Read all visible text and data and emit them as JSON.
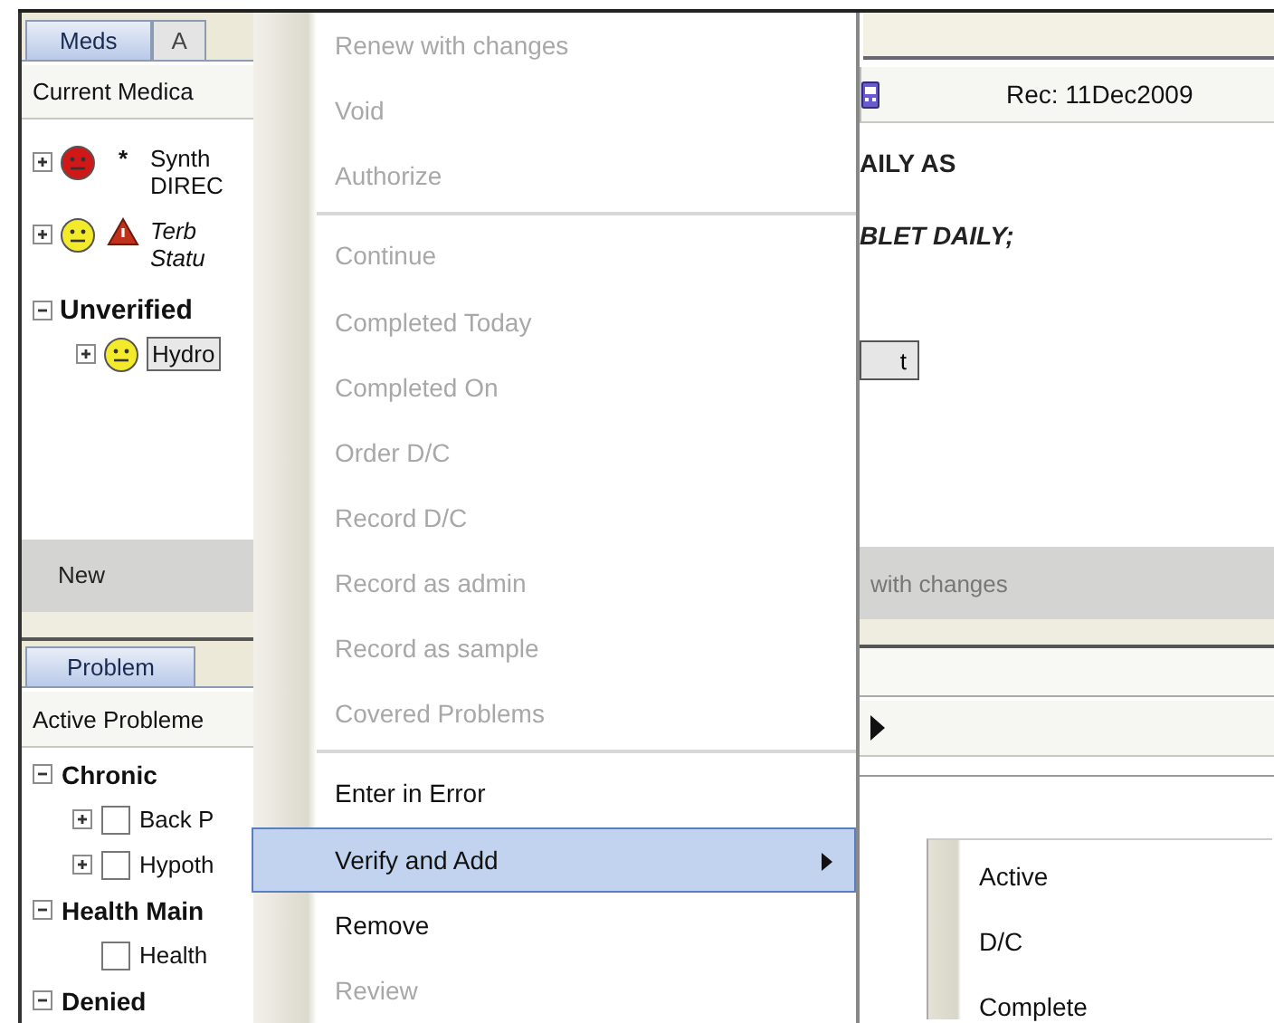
{
  "meds_panel": {
    "tabs": [
      {
        "label": "Meds",
        "selected": true
      },
      {
        "label": "A",
        "selected": false
      }
    ],
    "header": "Current Medica",
    "record_date": "Rec: 11Dec2009",
    "rows": [
      {
        "kind": "med",
        "color": "#d01818",
        "marker": "*",
        "italic": false,
        "expanded": false,
        "lines": [
          "Synth",
          "DIREC"
        ],
        "detail": "AILY AS"
      },
      {
        "kind": "med",
        "color": "#f2ea2a",
        "alert": true,
        "italic": true,
        "expanded": false,
        "lines": [
          "Terb",
          "Statu"
        ],
        "detail": "BLET DAILY;"
      },
      {
        "kind": "group",
        "label": "Unverified",
        "expanded": true,
        "children": [
          {
            "label": "Hydro",
            "color": "#f2ea2a",
            "expanded": false,
            "selected": true,
            "button": "t"
          }
        ]
      }
    ],
    "buttons": [
      {
        "label": "New",
        "disabled": false
      },
      {
        "label": "with changes",
        "disabled": true
      }
    ]
  },
  "problems_panel": {
    "tabs": [
      {
        "label": "Problem",
        "selected": true
      }
    ],
    "header": "Active Probleme",
    "groups": [
      {
        "label": "Chronic",
        "expanded": true,
        "children": [
          {
            "label": "Back P",
            "checked": false,
            "expanded": false
          },
          {
            "label": "Hypoth",
            "checked": false,
            "expanded": false
          }
        ]
      },
      {
        "label": "Health Main",
        "expanded": true,
        "children": [
          {
            "label": "Health",
            "checked": false
          }
        ]
      },
      {
        "label": "Denied",
        "expanded": true
      }
    ]
  },
  "context_menu": {
    "items": [
      {
        "kind": "item",
        "label": "Renew with changes",
        "disabled": true,
        "selected": false,
        "submenu": false
      },
      {
        "kind": "item",
        "label": "Void",
        "disabled": true,
        "selected": false,
        "submenu": false
      },
      {
        "kind": "item",
        "label": "Authorize",
        "disabled": true,
        "selected": false,
        "submenu": false
      },
      {
        "kind": "separator"
      },
      {
        "kind": "item",
        "label": "Continue",
        "disabled": true,
        "selected": false,
        "submenu": false
      },
      {
        "kind": "item",
        "label": "Completed Today",
        "disabled": true,
        "selected": false,
        "submenu": false
      },
      {
        "kind": "item",
        "label": "Completed On",
        "disabled": true,
        "selected": false,
        "submenu": false
      },
      {
        "kind": "item",
        "label": "Order D/C",
        "disabled": true,
        "selected": false,
        "submenu": false
      },
      {
        "kind": "item",
        "label": "Record D/C",
        "disabled": true,
        "selected": false,
        "submenu": false
      },
      {
        "kind": "item",
        "label": "Record as admin",
        "disabled": true,
        "selected": false,
        "submenu": false
      },
      {
        "kind": "item",
        "label": "Record as sample",
        "disabled": true,
        "selected": false,
        "submenu": false
      },
      {
        "kind": "item",
        "label": "Covered Problems",
        "disabled": true,
        "selected": false,
        "submenu": false
      },
      {
        "kind": "separator"
      },
      {
        "kind": "item",
        "label": "Enter in Error",
        "disabled": false,
        "selected": false,
        "submenu": false
      },
      {
        "kind": "item",
        "label": "Verify and Add",
        "disabled": false,
        "selected": true,
        "submenu": true
      },
      {
        "kind": "item",
        "label": "Remove",
        "disabled": false,
        "selected": false,
        "submenu": false
      },
      {
        "kind": "item",
        "label": "Review",
        "disabled": true,
        "selected": false,
        "submenu": false
      }
    ]
  },
  "submenu": {
    "items": [
      {
        "label": "Active",
        "selected": false
      },
      {
        "label": "D/C",
        "selected": false
      },
      {
        "label": "Complete",
        "selected": false
      }
    ]
  }
}
